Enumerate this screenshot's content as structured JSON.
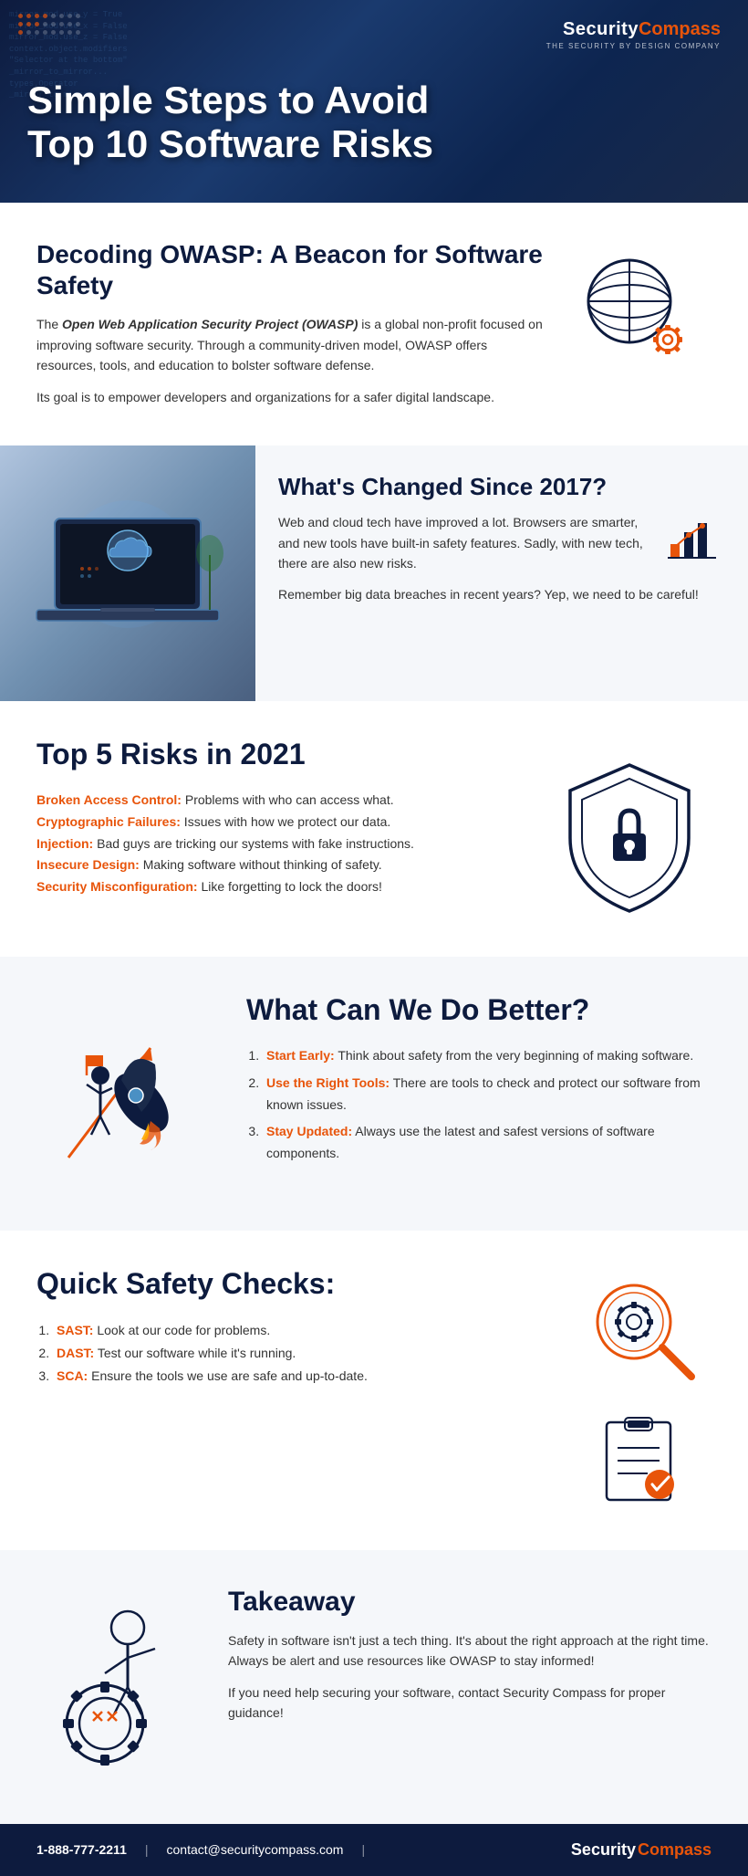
{
  "logo": {
    "security": "Security",
    "compass": "Compass",
    "tagline": "THE SECURITY BY DESIGN COMPANY"
  },
  "header": {
    "title": "Simple Steps to Avoid Top 10 Software Risks"
  },
  "owasp_section": {
    "title": "Decoding OWASP: A Beacon for Software Safety",
    "paragraph1": "The Open Web Application Security Project (OWASP) is a global non-profit focused on improving software security. Through a community-driven model, OWASP offers resources, tools, and education to bolster software defense.",
    "bold_italic_part": "Open Web Application Security Project (OWASP)",
    "paragraph2": "Its goal is to empower developers and organizations for a safer digital landscape."
  },
  "changed_section": {
    "title": "What's Changed Since 2017?",
    "paragraph1": "Web and cloud tech have improved a lot. Browsers are smarter, and new tools have built-in safety features. Sadly, with new tech, there are also new risks.",
    "paragraph2": "Remember big data breaches in recent years? Yep, we need to be careful!"
  },
  "risks_section": {
    "title": "Top 5 Risks in 2021",
    "risks": [
      {
        "label": "Broken Access Control:",
        "text": " Problems with who can access what."
      },
      {
        "label": "Cryptographic Failures:",
        "text": " Issues with how we protect our data."
      },
      {
        "label": "Injection:",
        "text": " Bad guys are tricking our systems with fake instructions."
      },
      {
        "label": "Insecure Design:",
        "text": " Making software without thinking of safety."
      },
      {
        "label": "Security Misconfiguration:",
        "text": " Like forgetting to lock the doors!"
      }
    ]
  },
  "better_section": {
    "title": "What Can We Do Better?",
    "items": [
      {
        "label": "Start Early:",
        "text": " Think about safety from the very beginning of making software."
      },
      {
        "label": "Use the Right Tools:",
        "text": " There are tools to check and protect our software from known issues."
      },
      {
        "label": "Stay Updated:",
        "text": " Always use the latest and safest versions of software components."
      }
    ]
  },
  "safety_section": {
    "title": "Quick Safety Checks:",
    "items": [
      {
        "label": "SAST:",
        "text": " Look at our code for problems."
      },
      {
        "label": "DAST:",
        "text": " Test our software while it's running."
      },
      {
        "label": "SCA:",
        "text": " Ensure the tools we use are safe and up-to-date."
      }
    ]
  },
  "takeaway_section": {
    "title": "Takeaway",
    "paragraph1": "Safety in software isn't just a tech thing. It's about the right approach at the right time. Always be alert and use resources like OWASP to stay informed!",
    "paragraph2": "If you need help securing your software, contact Security Compass for proper guidance!"
  },
  "footer": {
    "phone": "1-888-777-2211",
    "separator1": "|",
    "email": "contact@securitycompass.com",
    "separator2": "|",
    "logo_security": "Security",
    "logo_compass": "Compass"
  }
}
